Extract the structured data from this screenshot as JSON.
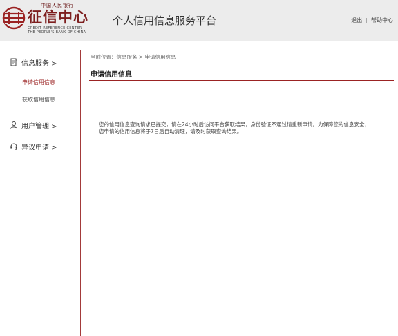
{
  "header": {
    "logo_top_text": "中国人民银行",
    "logo_main_text": "征信中心",
    "logo_sub_line1": "CREDIT REFERENCE CENTER",
    "logo_sub_line2": "THE PEOPLE'S BANK OF CHINA",
    "site_title": "个人信用信息服务平台",
    "links": {
      "logout": "退出",
      "separator": "|",
      "help": "帮助中心"
    },
    "brand_color": "#9b2323"
  },
  "sidebar": {
    "groups": [
      {
        "label": "信息服务 >",
        "icon": "document-icon",
        "items": [
          {
            "label": "申请信用信息",
            "active": true
          },
          {
            "label": "获取信用信息",
            "active": false
          }
        ]
      },
      {
        "label": "用户管理 >",
        "icon": "user-icon"
      },
      {
        "label": "异议申请 >",
        "icon": "headset-icon"
      }
    ]
  },
  "main": {
    "breadcrumb": {
      "prefix": "当前位置：",
      "level1": "信息服务",
      "sep": " > ",
      "level2": "申请信用信息"
    },
    "section_title": "申请信用信息",
    "message_line1": "您的信用信息查询请求已提交，请在24小时后访问平台获取结果，身份验证不通过请重新申请。为保障您的信息安全，",
    "message_line2": "您申请的信用信息将于7日后自动清理，请及时获取查询结果。"
  }
}
